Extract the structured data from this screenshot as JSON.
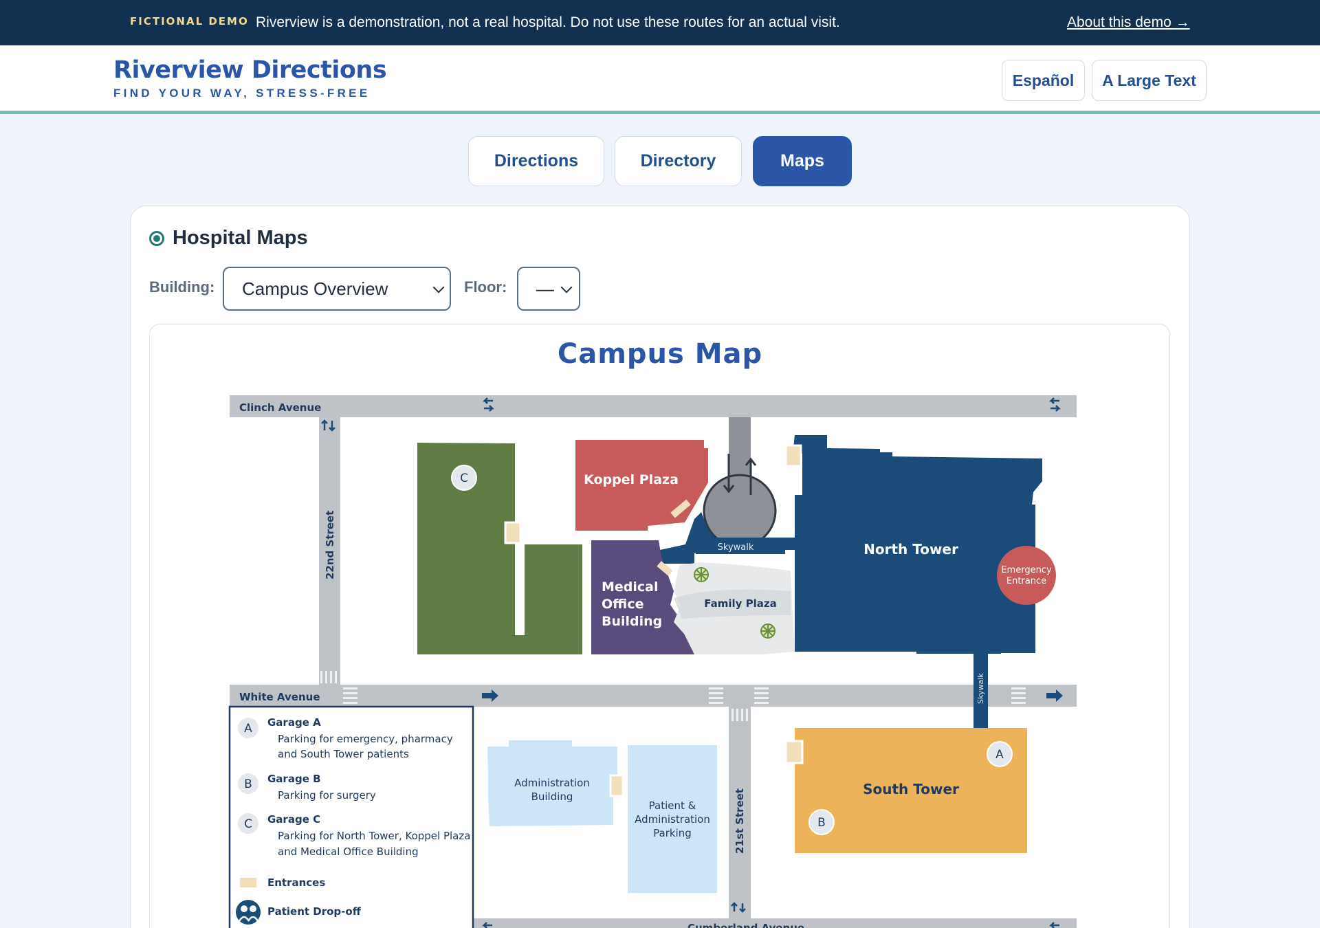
{
  "banner": {
    "tag": "FICTIONAL DEMO",
    "message": "Riverview is a demonstration, not a real hospital. Do not use these routes for an actual visit.",
    "about_link": "About this demo →"
  },
  "header": {
    "title": "Riverview Directions",
    "tagline": "FIND YOUR WAY, STRESS-FREE",
    "lang_button": "Español",
    "text_size_button": "A Large Text"
  },
  "tabs": [
    {
      "label": "Directions",
      "active": false
    },
    {
      "label": "Directory",
      "active": false
    },
    {
      "label": "Maps",
      "active": true
    }
  ],
  "panel": {
    "title": "Hospital Maps",
    "building_label": "Building:",
    "building_value": "Campus Overview",
    "floor_label": "Floor:",
    "floor_value": "—"
  },
  "map": {
    "title": "Campus Map",
    "streets": {
      "clinch": "Clinch Avenue",
      "white": "White Avenue",
      "s22": "22nd Street",
      "s21": "21st Street",
      "cumberland": "Cumberland Avenue"
    },
    "buildings": {
      "koppel": "Koppel Plaza",
      "north": "North Tower",
      "south": "South Tower",
      "mob_1": "Medical",
      "mob_2": "Office",
      "mob_3": "Building",
      "family": "Family Plaza",
      "admin_1": "Administration",
      "admin_2": "Building",
      "parking_1": "Patient &",
      "parking_2": "Administration",
      "parking_3": "Parking",
      "skywalk": "Skywalk",
      "skywalk2": "Skywalk",
      "emergency_1": "Emergency",
      "emergency_2": "Entrance"
    },
    "markers": {
      "a": "A",
      "b": "B",
      "c": "C"
    },
    "legend": {
      "garage_a_title": "Garage A",
      "garage_a_desc_1": "Parking for emergency, pharmacy",
      "garage_a_desc_2": "and South Tower patients",
      "garage_b_title": "Garage B",
      "garage_b_desc": "Parking for surgery",
      "garage_c_title": "Garage C",
      "garage_c_desc_1": "Parking for North Tower, Koppel Plaza",
      "garage_c_desc_2": "and Medical Office Building",
      "entrances": "Entrances",
      "dropoff": "Patient Drop-off"
    },
    "colors": {
      "road": "#bfc3c8",
      "garage_c": "#617b44",
      "koppel": "#c75a5a",
      "north_tower": "#1b4b78",
      "mob": "#594c7c",
      "south_tower": "#ecb35b",
      "admin": "#cde6f7",
      "emergency": "#c75a5a",
      "entrance": "#f1dfbb"
    }
  }
}
